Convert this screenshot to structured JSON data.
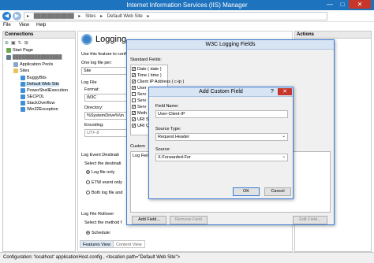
{
  "window": {
    "title": "Internet Information Services (IIS) Manager",
    "min": "—",
    "max": "□",
    "close": "✕"
  },
  "address": {
    "crumbs": [
      "▸",
      "████████████",
      "▸",
      "Sites",
      "▸",
      "Default Web Site",
      "▸"
    ]
  },
  "menu": {
    "file": "File",
    "view": "View",
    "help": "Help"
  },
  "connections": {
    "header": "Connections",
    "items": [
      "Start Page",
      "████████████████",
      "Application Pools",
      "Sites",
      "BuggyBits",
      "Default Web Site",
      "PowerShellExecution",
      "SECPOL",
      "StackOverflow",
      "Win32Exception"
    ]
  },
  "main": {
    "title": "Logging",
    "description": "Use this feature to config",
    "one_log_label": "One log file per:",
    "one_log_value": "Site",
    "log_file_header": "Log File",
    "format_label": "Format:",
    "format_value": "W3C",
    "directory_label": "Directory:",
    "directory_value": "%SystemDrive%\\in",
    "encoding_label": "Encoding:",
    "encoding_value": "UTF-8",
    "event_dest_header": "Log Event Destinati",
    "event_dest_desc": "Select the destinati",
    "opt_log_file_only": "Log file only",
    "opt_etw_only": "ETW event only",
    "opt_both": "Both log file and",
    "rollover_header": "Log File Rollover",
    "rollover_desc": "Select the method f",
    "schedule_label": "Schedule:"
  },
  "tabs": {
    "features": "Features View",
    "content": "Content View"
  },
  "actions": {
    "header": "Actions"
  },
  "w3c": {
    "title": "W3C Logging Fields",
    "standard_label": "Standard Fields:",
    "fields": [
      "Date ( date )",
      "Time ( time )",
      "Client IP Address ( c-ip )",
      "User",
      "Serv",
      "Serv",
      "Serv",
      "Meth",
      "URI S",
      "URI Q"
    ],
    "custom_label": "Custom",
    "log_field_label": "Log Field",
    "add_field": "Add Field...",
    "remove_field": "Remove Field",
    "edit_field": "Edit Field..."
  },
  "custom": {
    "title": "Add Custom Field",
    "help": "?",
    "close": "✕",
    "field_name_label": "Field Name:",
    "field_name_value": "User-Client-IP",
    "source_type_label": "Source Type:",
    "source_type_value": "Request Header",
    "source_label": "Source:",
    "source_value": "X-Forwarded-For",
    "ok": "OK",
    "cancel": "Cancel"
  },
  "status": {
    "text": "Configuration: 'localhost' applicationHost.config , <location path=\"Default Web Site\">"
  }
}
